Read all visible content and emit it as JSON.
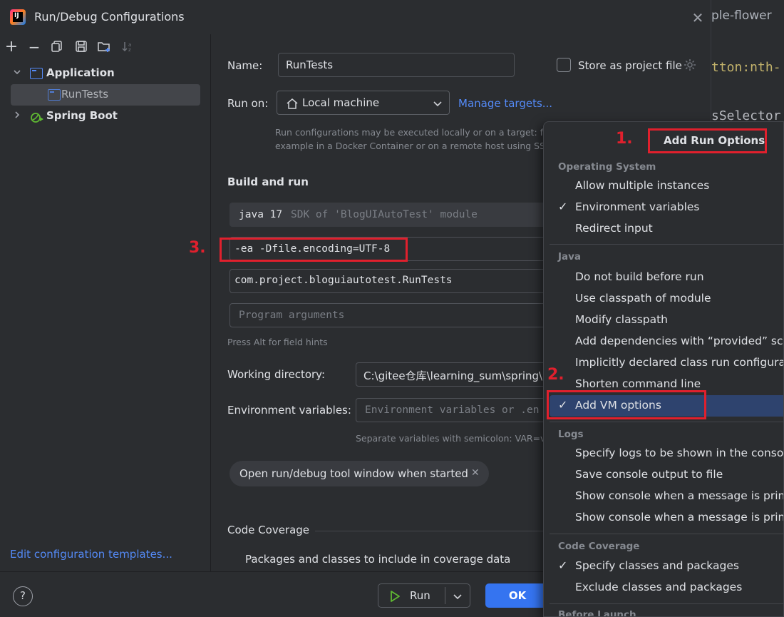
{
  "background_editor": {
    "line1": "ple-flower",
    "line2": "tton:nth-",
    "line3": "sSelector"
  },
  "dialog": {
    "title": "Run/Debug Configurations",
    "app_icon_text": "IJ"
  },
  "sidebar": {
    "toolbar": [
      "+",
      "−",
      "⧉",
      "💾",
      "📁",
      "↓z"
    ],
    "tree": [
      {
        "label": "Application",
        "expanded": true
      },
      {
        "label": "RunTests",
        "selected": true
      },
      {
        "label": "Spring Boot",
        "expanded": false
      }
    ],
    "edit_templates": "Edit configuration templates..."
  },
  "form": {
    "name_label": "Name:",
    "name_value": "RunTests",
    "store_label": "Store as project file",
    "run_on_label": "Run on:",
    "run_on_value": "Local machine",
    "manage_targets": "Manage targets...",
    "run_on_hint_1": "Run configurations may be executed locally or on a target: fo",
    "run_on_hint_2": "example in a Docker Container or on a remote host using SSI",
    "build_and_run": "Build and run",
    "sdk_java": "java 17",
    "sdk_detail": "SDK of 'BlogUIAutoTest' module",
    "vm_options": "-ea -Dfile.encoding=UTF-8",
    "main_class": "com.project.bloguiautotest.RunTests",
    "program_args_placeholder": "Program arguments",
    "field_hint": "Press Alt for field hints",
    "working_dir_label": "Working directory:",
    "working_dir_value": "C:\\gitee仓库\\learning_sum\\spring\\l",
    "env_label": "Environment variables:",
    "env_placeholder": "Environment variables or .en",
    "env_hint": "Separate variables with semicolon: VAR=va",
    "open_tool_window_chip": "Open run/debug tool window when started",
    "code_coverage": "Code Coverage",
    "packages_label": "Packages and classes to include in coverage data"
  },
  "footer": {
    "help": "?",
    "run": "Run",
    "ok": "OK"
  },
  "popup": {
    "title": "Add Run Options",
    "groups": [
      {
        "heading": "Operating System",
        "items": [
          {
            "label": "Allow multiple instances",
            "checked": false
          },
          {
            "label": "Environment variables",
            "checked": true
          },
          {
            "label": "Redirect input",
            "checked": false
          }
        ]
      },
      {
        "heading": "Java",
        "items": [
          {
            "label": "Do not build before run",
            "checked": false
          },
          {
            "label": "Use classpath of module",
            "checked": false
          },
          {
            "label": "Modify classpath",
            "checked": false
          },
          {
            "label": "Add dependencies with “provided” scop",
            "checked": false
          },
          {
            "label": "Implicitly declared class run configuratio",
            "checked": false
          },
          {
            "label": "Shorten command line",
            "checked": false
          },
          {
            "label": "Add VM options",
            "checked": true,
            "selected": true
          }
        ]
      },
      {
        "heading": "Logs",
        "items": [
          {
            "label": "Specify logs to be shown in the console",
            "checked": false
          },
          {
            "label": "Save console output to file",
            "checked": false
          },
          {
            "label": "Show console when a message is printed",
            "checked": false
          },
          {
            "label": "Show console when a message is printed",
            "checked": false
          }
        ]
      },
      {
        "heading": "Code Coverage",
        "items": [
          {
            "label": "Specify classes and packages",
            "checked": true
          },
          {
            "label": "Exclude classes and packages",
            "checked": false
          }
        ]
      },
      {
        "heading": "Before Launch",
        "items": []
      }
    ],
    "checkmark": "✓"
  },
  "annotations": {
    "n1": "1.",
    "n2": "2.",
    "n3": "3.",
    "color": "#e0202d"
  }
}
